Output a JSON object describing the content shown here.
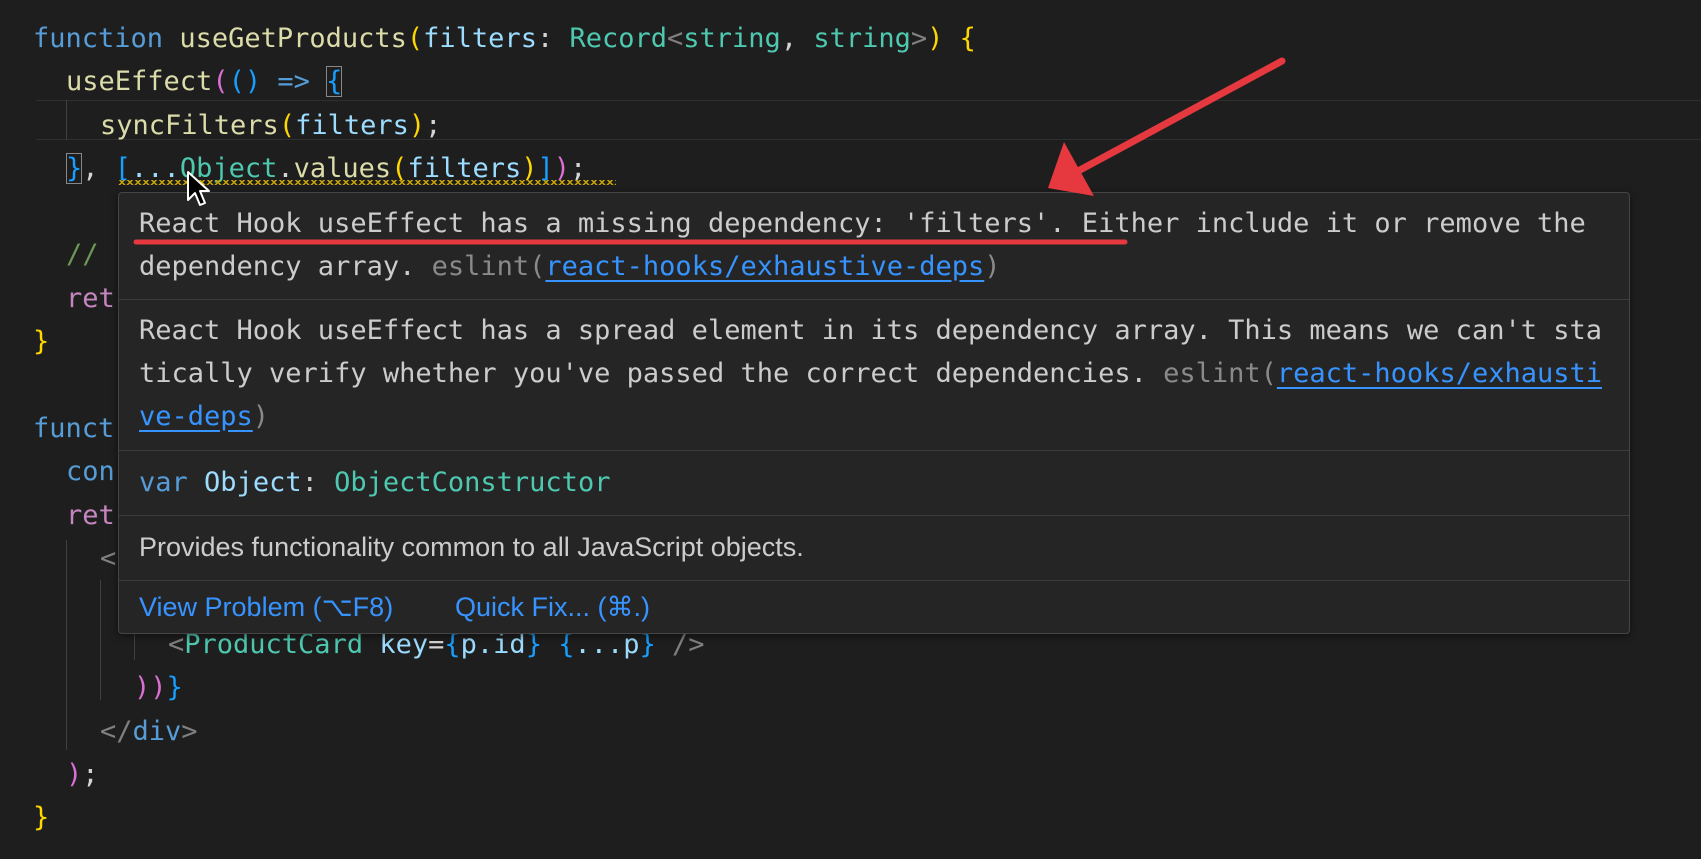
{
  "code": {
    "line1": {
      "kw_function": "function",
      "fn_name": "useGetProducts",
      "open_paren": "(",
      "param": "filters",
      "colon": ": ",
      "type_record": "Record",
      "lt": "<",
      "type_s1": "string",
      "comma": ", ",
      "type_s2": "string",
      "gt": ">",
      "close_paren": ")",
      "open_brace": " {"
    },
    "line2": {
      "fn": "useEffect",
      "open_paren": "(",
      "arrow_params": "()",
      "arrow": " => ",
      "open_brace": "{"
    },
    "line3": {
      "fn": "syncFilters",
      "open_paren": "(",
      "arg": "filters",
      "close_paren": ")",
      "semi": ";"
    },
    "line4": {
      "close_brace": "}",
      "comma": ", ",
      "open_bracket": "[",
      "spread": "...",
      "obj": "Object",
      "dot": ".",
      "method": "values",
      "open_paren": "(",
      "arg": "filters",
      "close_paren": ")",
      "close_bracket": "]",
      "close_outer": ")",
      "semi": ";"
    },
    "line6_comment": "//",
    "line7_ret": "ret",
    "line8_brace": "}",
    "line10_funct": "funct",
    "line11_con": "con",
    "line12_ret": "ret",
    "line13_lt": "<",
    "line15": {
      "lt": "<",
      "component": "ProductCard",
      "attr": "key",
      "eq": "=",
      "open_brace": "{",
      "expr": "p.id",
      "close_brace": "}",
      "spread_open": "{",
      "spread": "...p",
      "spread_close": "}",
      "self_close": " />"
    },
    "line16": {
      "parens": "))",
      "brace": "}"
    },
    "line17": {
      "lt": "</",
      "tag": "div",
      "gt": ">"
    },
    "line18": {
      "paren": ")",
      "semi": ";"
    },
    "line19": {
      "brace": "}"
    }
  },
  "hover": {
    "problem1": {
      "message": "React Hook useEffect has a missing dependency: 'filters'. Either include it or remove the dependency array.",
      "source_prefix": " eslint(",
      "rule": "react-hooks/exhaustive-deps",
      "source_suffix": ")"
    },
    "problem2": {
      "message": "React Hook useEffect has a spread element in its dependency array. This means we can't statically verify whether you've passed the correct dependencies.",
      "source_prefix": " eslint(",
      "rule": "react-hooks/exhaustive-deps",
      "source_suffix": ")"
    },
    "signature": {
      "kw": "var",
      "name": "Object",
      "colon": ": ",
      "type": "ObjectConstructor"
    },
    "doc": "Provides functionality common to all JavaScript objects.",
    "actions": {
      "view_problem": "View Problem (⌥F8)",
      "quick_fix": "Quick Fix... (⌘.)"
    }
  },
  "colors": {
    "background": "#1e1e1e",
    "hover_background": "#252526",
    "link": "#3794ff",
    "annotation_red": "#e5393f",
    "warning_squiggle": "#cca700"
  }
}
